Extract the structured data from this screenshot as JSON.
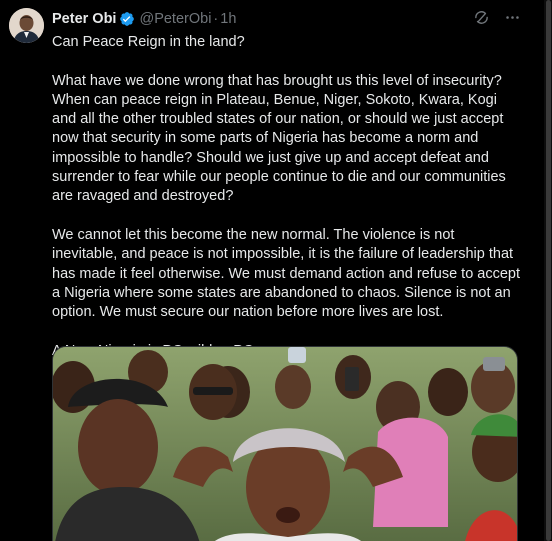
{
  "tweet": {
    "author_name": "Peter Obi",
    "handle": "@PeterObi",
    "separator": "·",
    "time": "1h",
    "paragraphs": [
      "Can Peace Reign in the land?",
      "What have we done wrong that has brought us this level of insecurity? When can peace reign in Plateau, Benue, Niger, Sokoto, Kwara, Kogi and all the other troubled states of our nation, or should we just accept now that security in some parts of Nigeria has become a norm and impossible to handle? Should we just give up and accept defeat and surrender to fear while our people continue to die and our communities are ravaged and destroyed?",
      "We cannot let this become the new normal. The violence is not inevitable, and peace is not impossible, it is the failure of leadership that has made it feel otherwise. We must demand action and refuse to accept a Nigeria where some states are abandoned to chaos. Silence is not an option. We must secure our nation before more lives are lost.",
      "A New Nigeria is POssible. -PO"
    ]
  },
  "icons": {
    "verified": "verified-badge-icon",
    "grok": "grok-icon",
    "more": "more-options-icon"
  },
  "colors": {
    "background": "#000000",
    "text": "#e7e9ea",
    "muted": "#71767b",
    "verified": "#1d9bf0"
  }
}
